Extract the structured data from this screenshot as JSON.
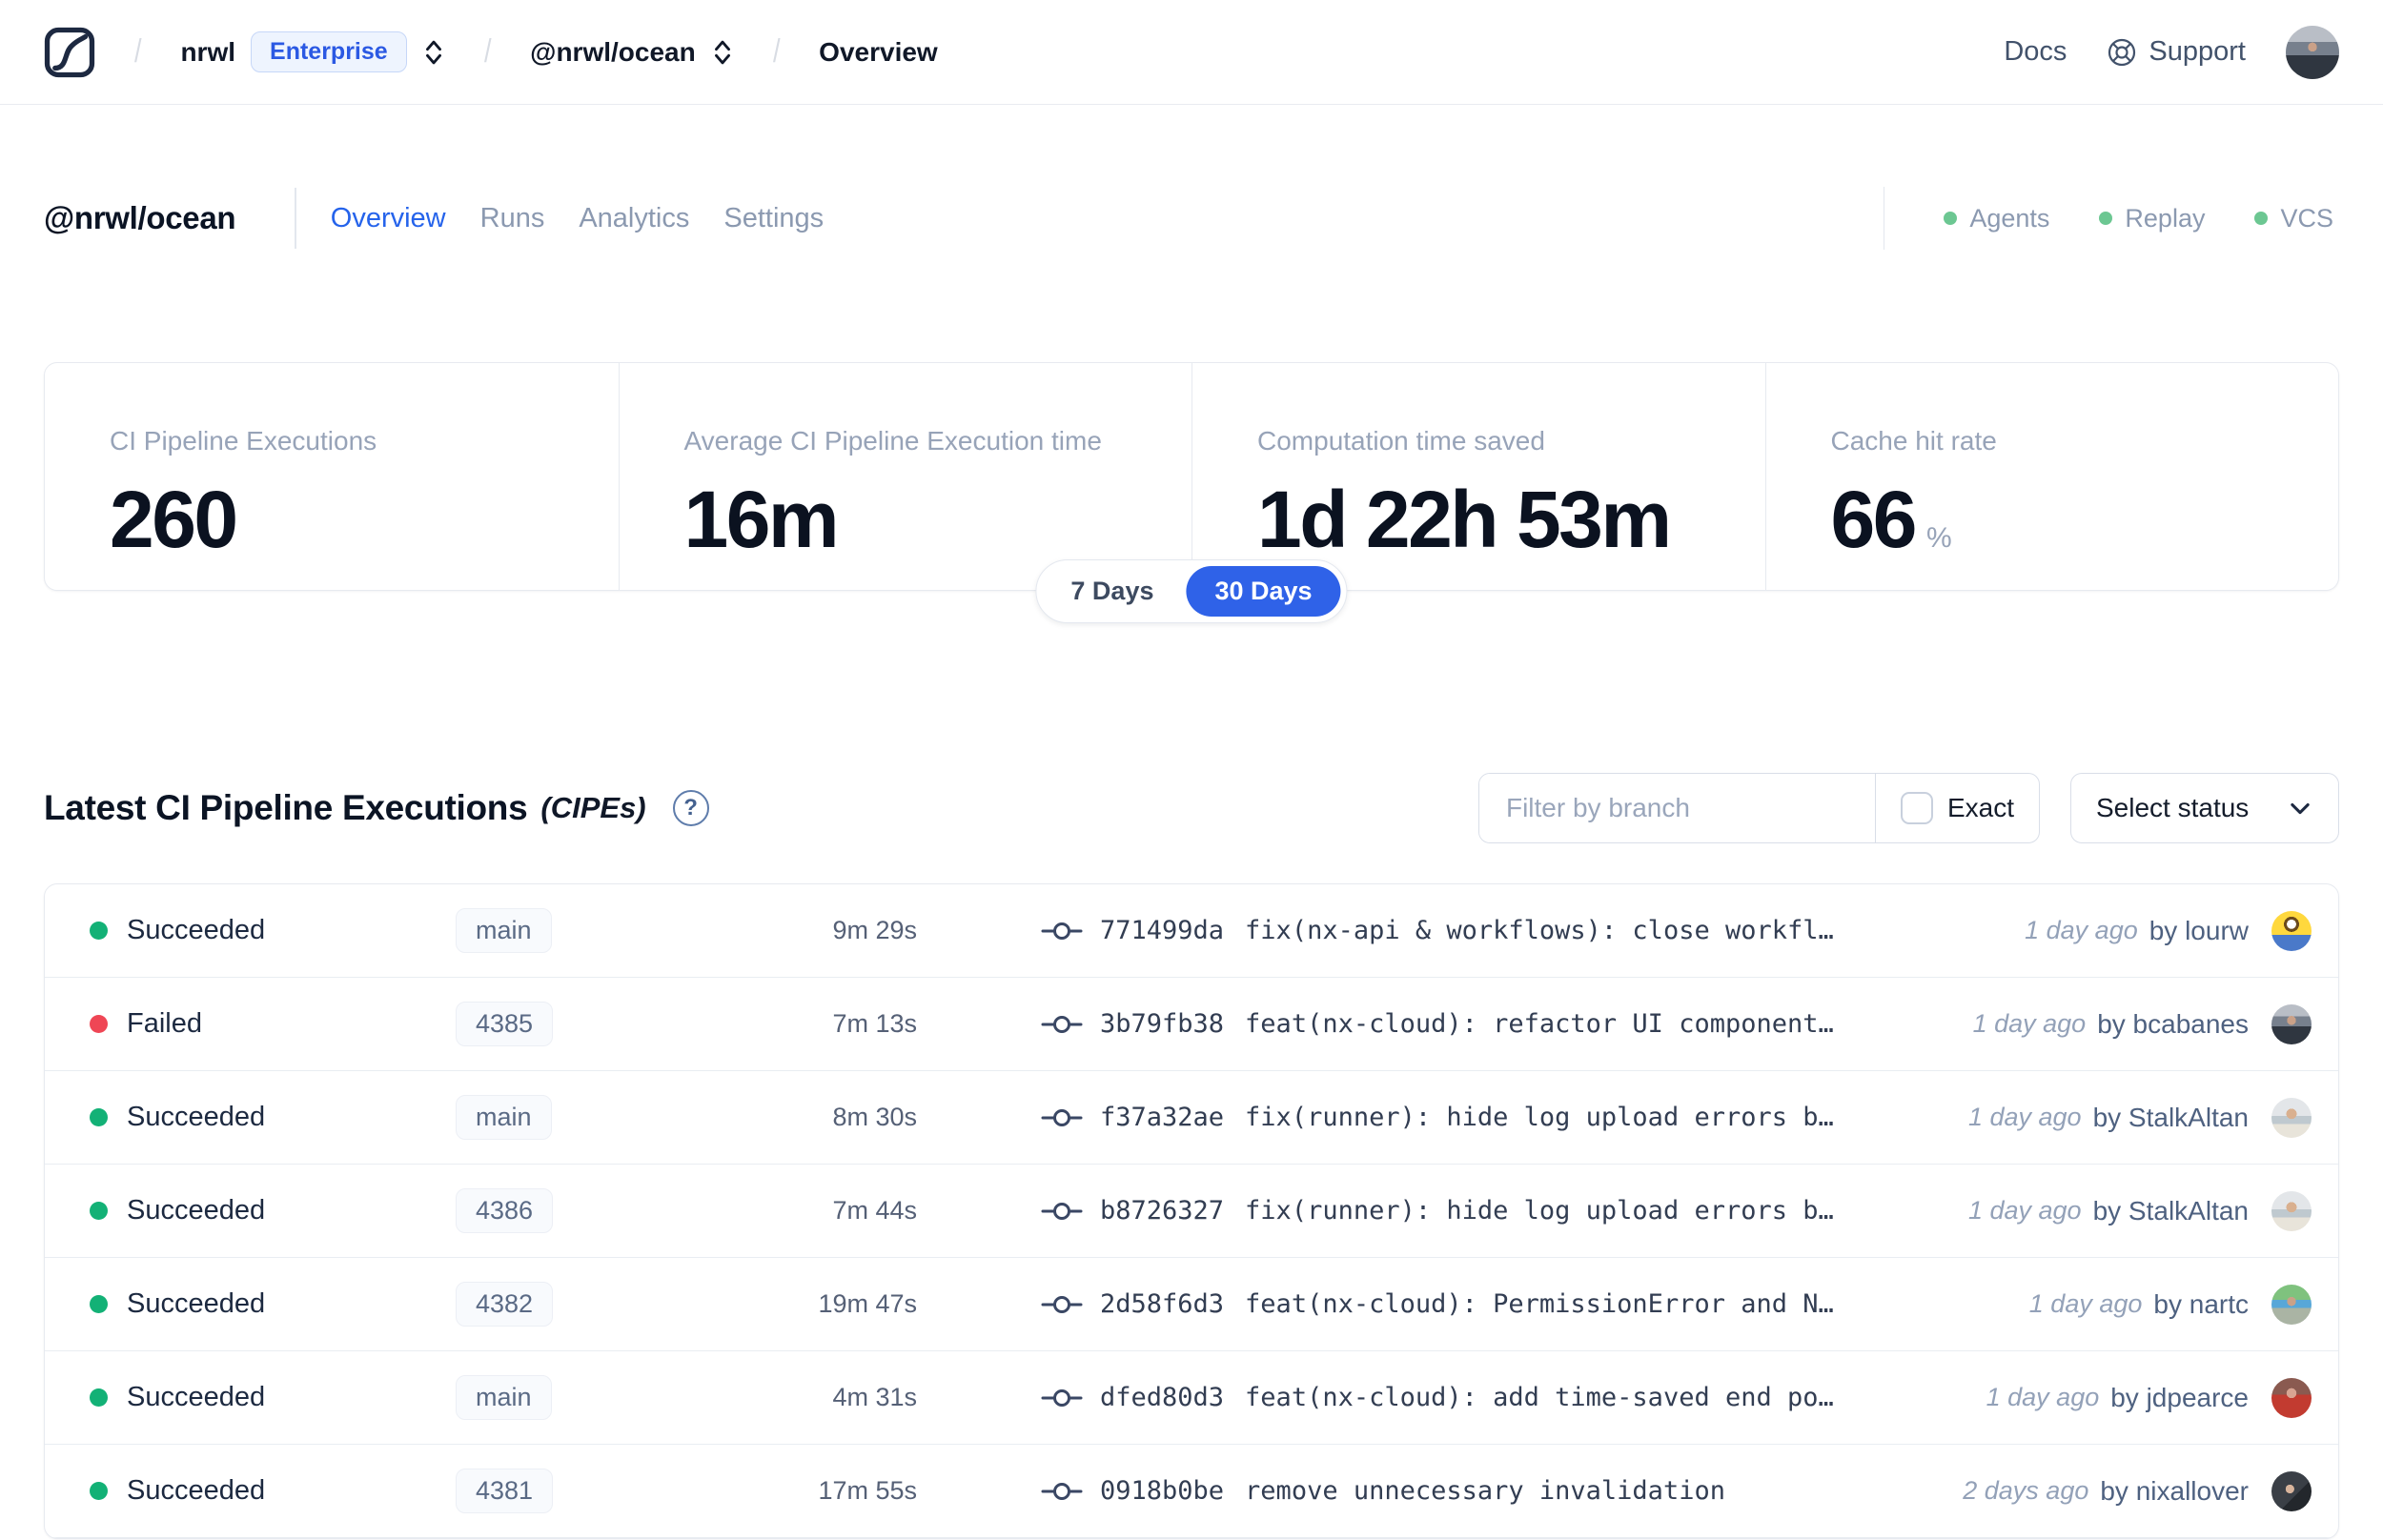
{
  "topbar": {
    "breadcrumb": {
      "org": "nrwl",
      "plan_badge": "Enterprise",
      "workspace": "@nrwl/ocean",
      "page": "Overview"
    },
    "links": {
      "docs": "Docs",
      "support": "Support"
    }
  },
  "workspace_header": {
    "title": "@nrwl/ocean",
    "tabs": [
      {
        "label": "Overview",
        "active": true
      },
      {
        "label": "Runs",
        "active": false
      },
      {
        "label": "Analytics",
        "active": false
      },
      {
        "label": "Settings",
        "active": false
      }
    ],
    "integrations": [
      "Agents",
      "Replay",
      "VCS"
    ]
  },
  "stats": {
    "cards": [
      {
        "label": "CI Pipeline Executions",
        "value": "260"
      },
      {
        "label": "Average CI Pipeline Execution time",
        "value": "16m"
      },
      {
        "label": "Computation time saved",
        "value": "1d 22h 53m"
      },
      {
        "label": "Cache hit rate",
        "value": "66",
        "suffix": "%"
      }
    ],
    "range_toggle": {
      "options": [
        "7 Days",
        "30 Days"
      ],
      "selected": "30 Days"
    }
  },
  "cipe_section": {
    "title": "Latest CI Pipeline Executions",
    "title_suffix": "(CIPEs)",
    "help_glyph": "?",
    "filters": {
      "branch_placeholder": "Filter by branch",
      "branch_value": "",
      "exact_label": "Exact",
      "exact_checked": false,
      "status_dropdown": "Select status"
    }
  },
  "table": {
    "rows": [
      {
        "status": "Succeeded",
        "branch": "main",
        "duration": "9m 29s",
        "commit_hash": "771499da",
        "commit_message": "fix(nx-api & workflows): close workfl…",
        "time_ago": "1 day ago",
        "author": "by lourw",
        "avatar": "minion"
      },
      {
        "status": "Failed",
        "branch": "4385",
        "duration": "7m 13s",
        "commit_hash": "3b79fb38",
        "commit_message": "feat(nx-cloud): refactor UI component…",
        "time_ago": "1 day ago",
        "author": "by bcabanes",
        "avatar": "street"
      },
      {
        "status": "Succeeded",
        "branch": "main",
        "duration": "8m 30s",
        "commit_hash": "f37a32ae",
        "commit_message": "fix(runner): hide log upload errors b…",
        "time_ago": "1 day ago",
        "author": "by StalkAltan",
        "avatar": "beach"
      },
      {
        "status": "Succeeded",
        "branch": "4386",
        "duration": "7m 44s",
        "commit_hash": "b8726327",
        "commit_message": "fix(runner): hide log upload errors b…",
        "time_ago": "1 day ago",
        "author": "by StalkAltan",
        "avatar": "beach"
      },
      {
        "status": "Succeeded",
        "branch": "4382",
        "duration": "19m 47s",
        "commit_hash": "2d58f6d3",
        "commit_message": "feat(nx-cloud): PermissionError and N…",
        "time_ago": "1 day ago",
        "author": "by nartc",
        "avatar": "outdoor"
      },
      {
        "status": "Succeeded",
        "branch": "main",
        "duration": "4m 31s",
        "commit_hash": "dfed80d3",
        "commit_message": "feat(nx-cloud): add time-saved end po…",
        "time_ago": "1 day ago",
        "author": "by jdpearce",
        "avatar": "red"
      },
      {
        "status": "Succeeded",
        "branch": "4381",
        "duration": "17m 55s",
        "commit_hash": "0918b0be",
        "commit_message": "remove unnecessary invalidation",
        "time_ago": "2 days ago",
        "author": "by nixallover",
        "avatar": "dark"
      }
    ]
  },
  "colors": {
    "accent_blue": "#2f62e8",
    "link_blue": "#2563eb",
    "succeeded": "#13b176",
    "failed": "#ef4655",
    "integration_dot": "#6cc792"
  }
}
